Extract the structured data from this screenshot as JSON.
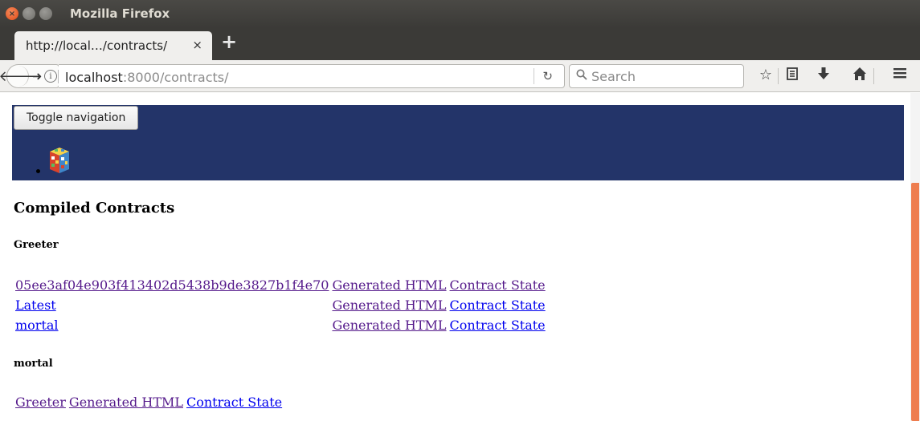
{
  "window": {
    "title": "Mozilla Firefox"
  },
  "tab": {
    "label": "http://local…/contracts/",
    "close_glyph": "×"
  },
  "new_tab_glyph": "+",
  "navbar": {
    "url_host": "localhost",
    "url_rest": ":8000/contracts/",
    "search_placeholder": "Search"
  },
  "page": {
    "toggle_label": "Toggle navigation",
    "heading": "Compiled Contracts",
    "groups": [
      {
        "name": "Greeter",
        "rows": [
          {
            "id": "05ee3af04e903f413402d5438b9de3827b1f4e70",
            "html": "Generated HTML",
            "state": "Contract State",
            "state_visited": true
          },
          {
            "id": "Latest",
            "html": "Generated HTML",
            "state": "Contract State",
            "id_visited": false,
            "state_visited": false
          },
          {
            "id": "mortal",
            "html": "Generated HTML",
            "state": "Contract State",
            "id_visited": false,
            "state_visited": false
          }
        ]
      },
      {
        "name": "mortal",
        "rows": [
          {
            "id": "Greeter",
            "html": "Generated HTML",
            "state": "Contract State",
            "state_visited": false
          }
        ]
      }
    ]
  },
  "colors": {
    "nav_background": "#233469",
    "visited_link": "#551a8b",
    "unvisited_link": "#0000ee",
    "scrollbar_thumb": "#ee7d4f"
  }
}
